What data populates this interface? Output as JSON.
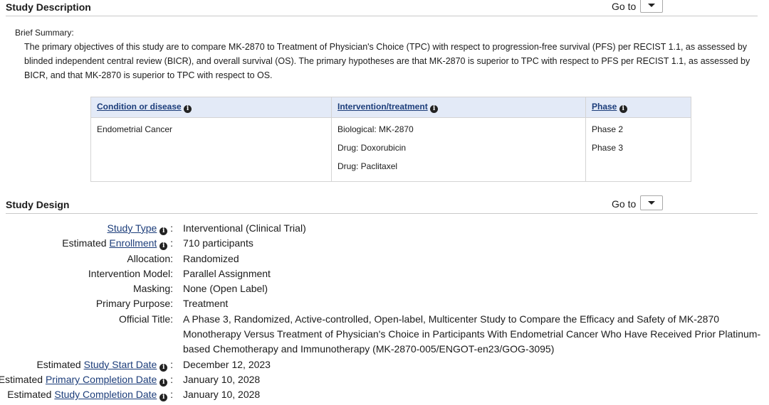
{
  "study_description": {
    "title": "Study Description",
    "goto_label": "Go to",
    "brief_summary_label": "Brief Summary:",
    "brief_summary": "The primary objectives of this study are to compare MK-2870 to Treatment of Physician's Choice (TPC) with respect to progression-free survival (PFS) per RECIST 1.1, as assessed by blinded independent central review (BICR), and overall survival (OS). The primary hypotheses are that MK-2870 is superior to TPC with respect to PFS per RECIST 1.1, as assessed by BICR, and that MK-2870 is superior to TPC with respect to OS.",
    "table": {
      "headers": [
        "Condition or disease",
        "Intervention/treatment",
        "Phase"
      ],
      "conditions": [
        "Endometrial Cancer"
      ],
      "interventions": [
        "Biological: MK-2870",
        "Drug: Doxorubicin",
        "Drug: Paclitaxel"
      ],
      "phases": [
        "Phase 2",
        "Phase 3"
      ]
    }
  },
  "study_design": {
    "title": "Study Design",
    "goto_label": "Go to",
    "rows": [
      {
        "prefix": "",
        "label": "Study Type",
        "link": true,
        "info": true,
        "value": "Interventional  (Clinical Trial)"
      },
      {
        "prefix": "Estimated ",
        "label": "Enrollment",
        "link": true,
        "info": true,
        "value": "710 participants"
      },
      {
        "prefix": "",
        "label": "Allocation:",
        "link": false,
        "info": false,
        "value": "Randomized"
      },
      {
        "prefix": "",
        "label": "Intervention Model:",
        "link": false,
        "info": false,
        "value": "Parallel Assignment"
      },
      {
        "prefix": "",
        "label": "Masking:",
        "link": false,
        "info": false,
        "value": "None (Open Label)"
      },
      {
        "prefix": "",
        "label": "Primary Purpose:",
        "link": false,
        "info": false,
        "value": "Treatment"
      },
      {
        "prefix": "",
        "label": "Official Title:",
        "link": false,
        "info": false,
        "value": "A Phase 3, Randomized, Active-controlled, Open-label, Multicenter Study to Compare the Efficacy and Safety of MK-2870 Monotherapy Versus Treatment of Physician's Choice in Participants With Endometrial Cancer Who Have Received Prior Platinum-based Chemotherapy and Immunotherapy (MK-2870-005/ENGOT-en23/GOG-3095)"
      },
      {
        "prefix": "Estimated ",
        "label": "Study Start Date",
        "link": true,
        "info": true,
        "value": "December 12, 2023"
      },
      {
        "prefix": "Estimated ",
        "label": "Primary Completion Date",
        "link": true,
        "info": true,
        "value": "January 10, 2028"
      },
      {
        "prefix": "Estimated ",
        "label": "Study Completion Date",
        "link": true,
        "info": true,
        "value": "January 10, 2028"
      }
    ]
  },
  "icons": {
    "info": "info-circle-icon",
    "dropdown": "caret-down-icon"
  }
}
